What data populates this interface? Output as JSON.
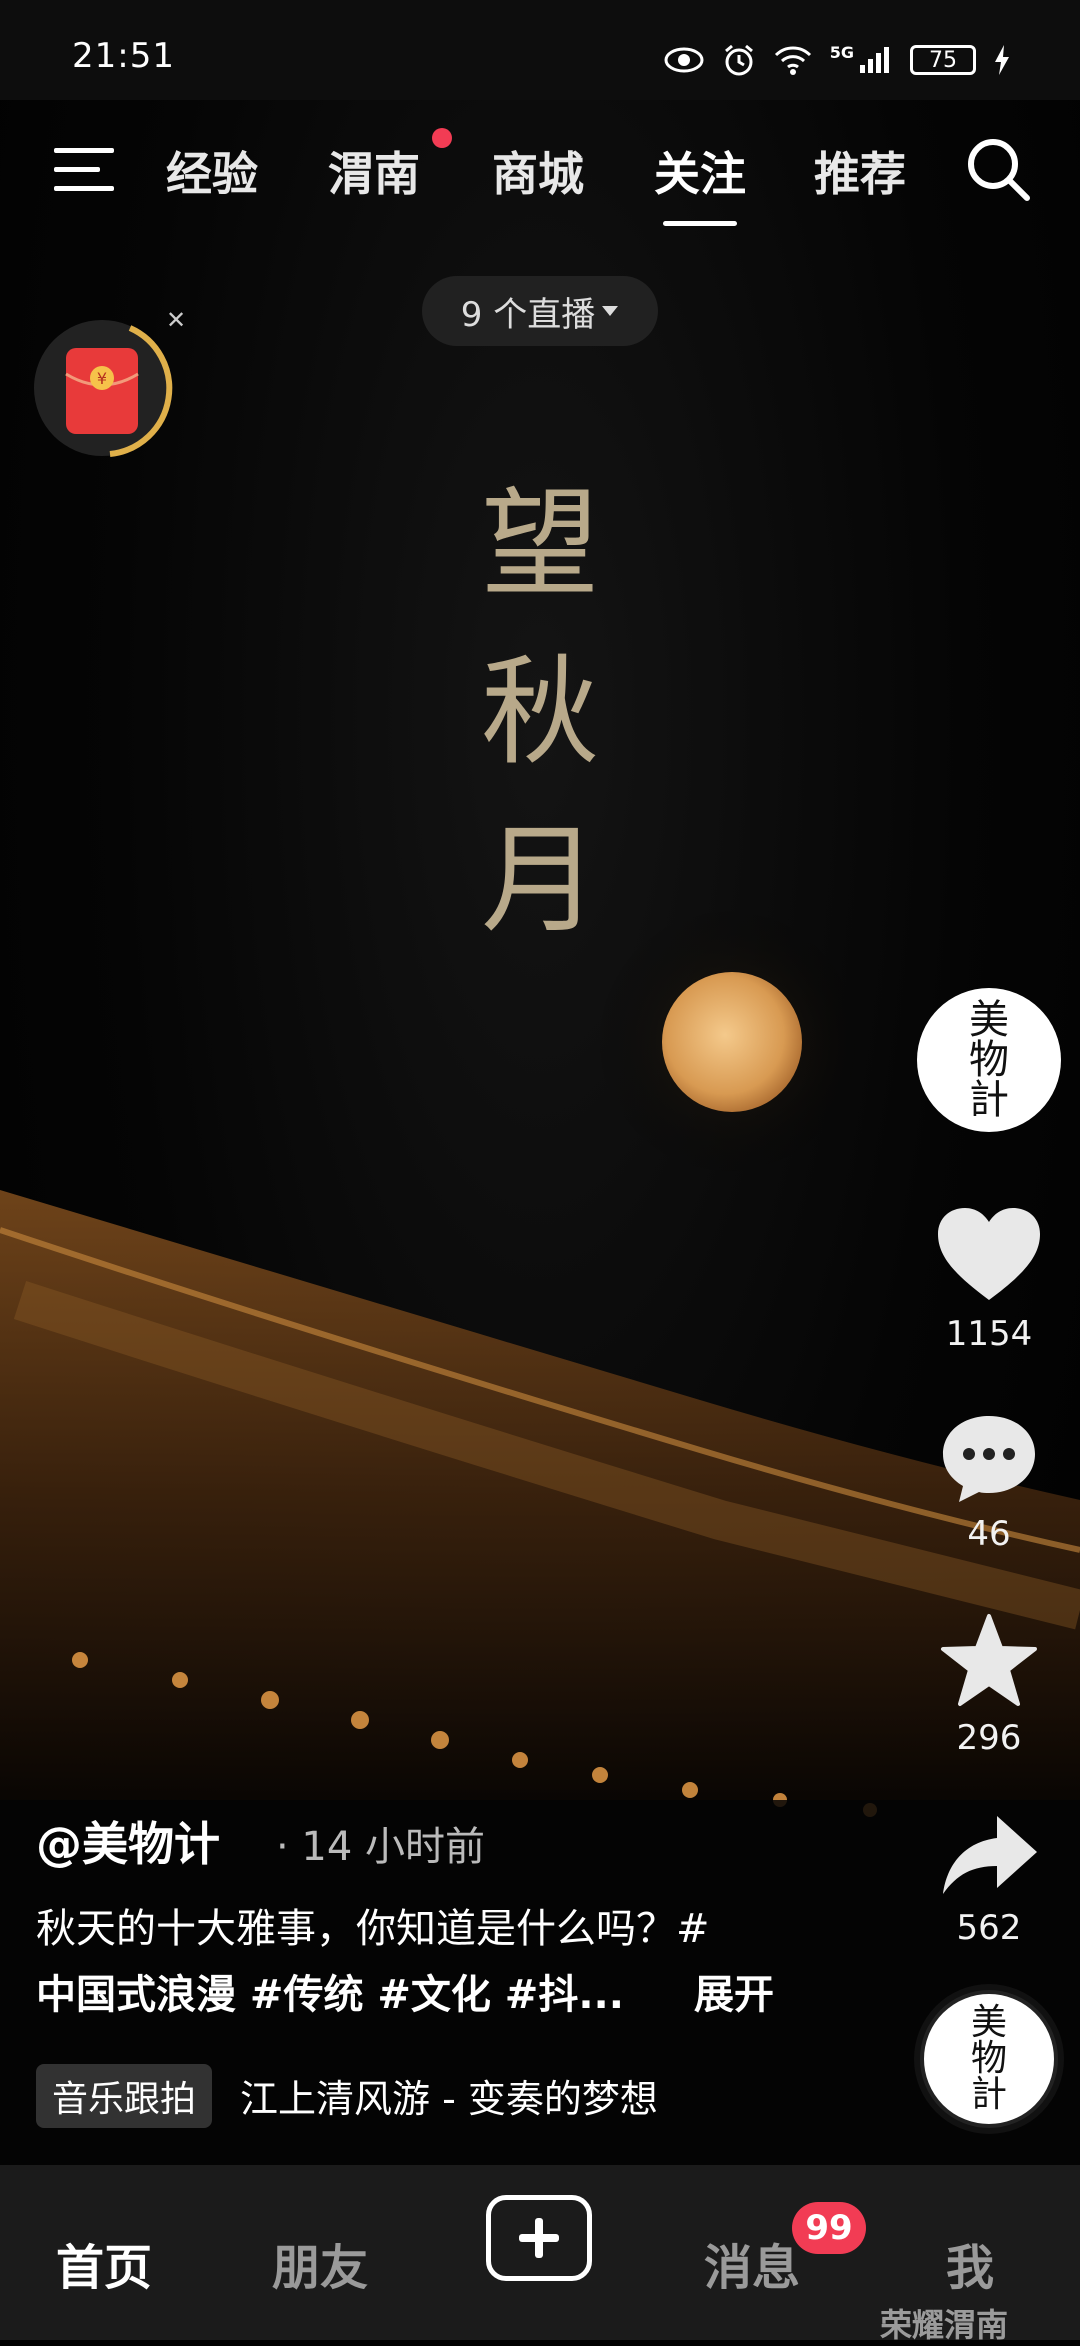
{
  "status_bar": {
    "time": "21:51",
    "network": "5G",
    "battery": "75"
  },
  "top_nav": {
    "tabs": [
      {
        "label": "经验"
      },
      {
        "label": "渭南",
        "has_dot": true
      },
      {
        "label": "商城"
      },
      {
        "label": "关注",
        "active": true
      },
      {
        "label": "推荐"
      }
    ]
  },
  "live_pill": {
    "label": "9 个直播"
  },
  "video": {
    "title_chars": [
      "望",
      "秋",
      "月"
    ]
  },
  "rail": {
    "avatar_text": "美物計",
    "likes": "1154",
    "comments": "46",
    "favorites": "296",
    "shares": "562",
    "music_disc_text": "美物計"
  },
  "caption": {
    "author": "@美物计",
    "time": "· 14 小时前",
    "line1": "秋天的十大雅事，你知道是什么吗？#",
    "line2": "中国式浪漫 #传统 #文化 #抖...",
    "expand": "展开",
    "music_badge": "音乐跟拍",
    "music_title": "江上清风游 - 变奏的梦想"
  },
  "bottom_nav": {
    "home": "首页",
    "friends": "朋友",
    "messages": "消息",
    "messages_badge": "99",
    "me": "我"
  },
  "watermark": "荣耀渭南",
  "colors": {
    "accent_red": "#f23c54",
    "calligraphy": "#b8a98a"
  }
}
